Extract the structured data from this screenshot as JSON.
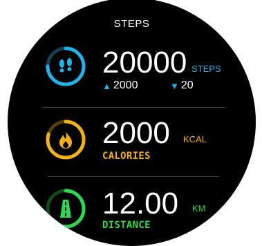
{
  "header": {
    "title": "STEPS"
  },
  "steps": {
    "value": "20000",
    "unit": "STEPS",
    "up_value": "2000",
    "down_value": "20",
    "icon": "footprints-icon",
    "color": "#1fb3ea",
    "progress": 0.75
  },
  "calories": {
    "value": "2000",
    "unit": "KCAL",
    "label": "CALORIES",
    "icon": "flame-icon",
    "color": "#f2b116",
    "progress": 0.8
  },
  "distance": {
    "value": "12.00",
    "unit": "KM",
    "label": "DISTANCE",
    "icon": "road-icon",
    "color": "#2dd94f",
    "progress": 0.65
  },
  "colors": {
    "background": "#000000",
    "separator": "#3a3a3a",
    "text": "#ffffff"
  }
}
